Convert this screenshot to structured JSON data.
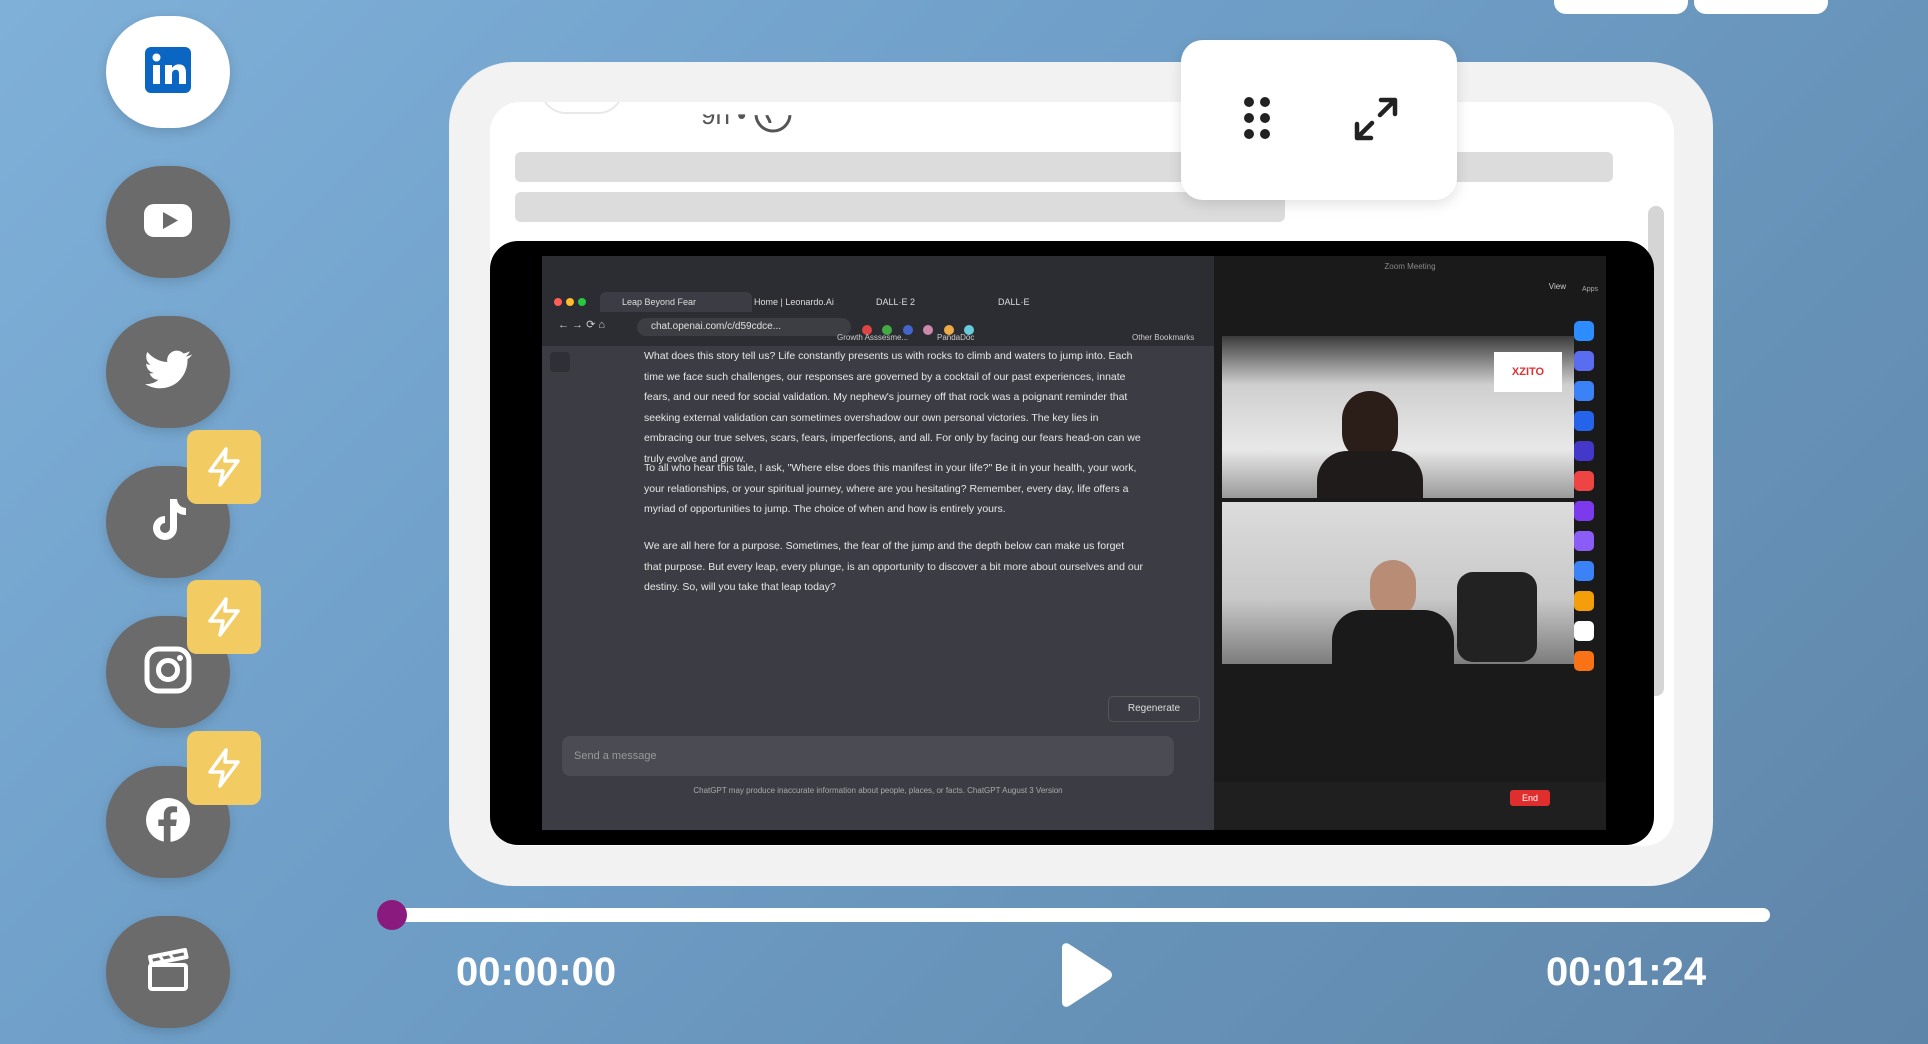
{
  "sidebar": {
    "items": [
      {
        "name": "linkedin",
        "icon": "linkedin-icon",
        "active": true
      },
      {
        "name": "youtube",
        "icon": "youtube-icon",
        "active": false
      },
      {
        "name": "twitter",
        "icon": "twitter-icon",
        "active": false
      },
      {
        "name": "tiktok",
        "icon": "tiktok-icon",
        "active": false,
        "badge": "lightning-icon"
      },
      {
        "name": "instagram",
        "icon": "instagram-icon",
        "active": false,
        "badge": "lightning-icon"
      },
      {
        "name": "facebook",
        "icon": "facebook-icon",
        "active": false,
        "badge": "lightning-icon"
      },
      {
        "name": "clapperboard",
        "icon": "clapperboard-icon",
        "active": false
      }
    ]
  },
  "colors": {
    "accent": "#8b1a7e",
    "badge": "#f2cc62",
    "active_sidebar": "#ffffff",
    "inactive_sidebar": "#6b6b6b"
  },
  "post": {
    "meta_text": "9h •"
  },
  "panel": {
    "drag_icon": "drag-handle-icon",
    "expand_icon": "expand-icon"
  },
  "video": {
    "browser": {
      "tabs": [
        "Leap Beyond Fear",
        "Home | Leonardo.Ai",
        "DALL·E 2",
        "DALL·E"
      ],
      "url": "chat.openai.com/c/d59cdce...",
      "bookmarks": [
        "Growth Asssesme...",
        "PandaDoc",
        "Other Bookmarks"
      ]
    },
    "chat": {
      "paragraphs": [
        "What does this story tell us? Life constantly presents us with rocks to climb and waters to jump into. Each time we face such challenges, our responses are governed by a cocktail of our past experiences, innate fears, and our need for social validation. My nephew's journey off that rock was a poignant reminder that seeking external validation can sometimes overshadow our own personal victories. The key lies in embracing our true selves, scars, fears, imperfections, and all. For only by facing our fears head-on can we truly evolve and grow.",
        "To all who hear this tale, I ask, \"Where else does this manifest in your life?\" Be it in your health, your work, your relationships, or your spiritual journey, where are you hesitating? Remember, every day, life offers a myriad of opportunities to jump. The choice of when and how is entirely yours.",
        "We are all here for a purpose. Sometimes, the fear of the jump and the depth below can make us forget that purpose. But every leap, every plunge, is an opportunity to discover a bit more about ourselves and our destiny. So, will you take that leap today?"
      ],
      "regenerate_label": "Regenerate",
      "input_placeholder": "Send a message",
      "disclaimer": "ChatGPT may produce inaccurate information about people, places, or facts. ChatGPT August 3 Version"
    },
    "zoom": {
      "title": "Zoom Meeting",
      "view_label": "View",
      "apps_label": "Apps",
      "sign_text": "XZITO",
      "end_label": "End"
    }
  },
  "player": {
    "current_time": "00:00:00",
    "duration": "00:01:24",
    "progress": 0.0
  }
}
